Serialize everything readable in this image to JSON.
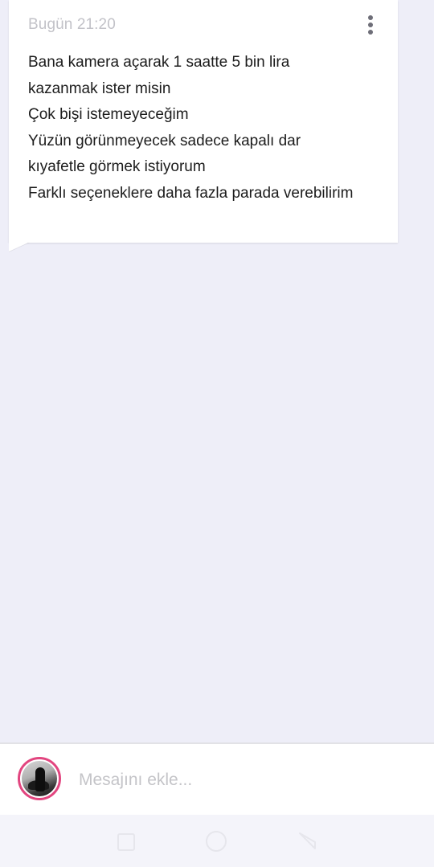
{
  "message": {
    "timestamp": "Bugün 21:20",
    "lines": [
      "Bana kamera açarak 1 saatte 5 bin lira",
      "kazanmak ister misin",
      "Çok bişi istemeyeceğim",
      "Yüzün görünmeyecek sadece kapalı dar",
      "kıyafetle görmek istiyorum",
      "Farklı seçeneklere daha fazla parada verebilirim"
    ],
    "menu_icon": "more-vertical-icon"
  },
  "composer": {
    "placeholder": "Mesajını ekle...",
    "value": "",
    "avatar_ring_color": "#e2457f"
  },
  "navigation": {
    "recents_icon": "square-icon",
    "home_icon": "circle-icon",
    "back_icon": "triangle-back-icon"
  },
  "colors": {
    "background": "#eeeef8",
    "bubble": "#ffffff",
    "text": "#1c1c1c",
    "muted": "#c2c2c8"
  }
}
